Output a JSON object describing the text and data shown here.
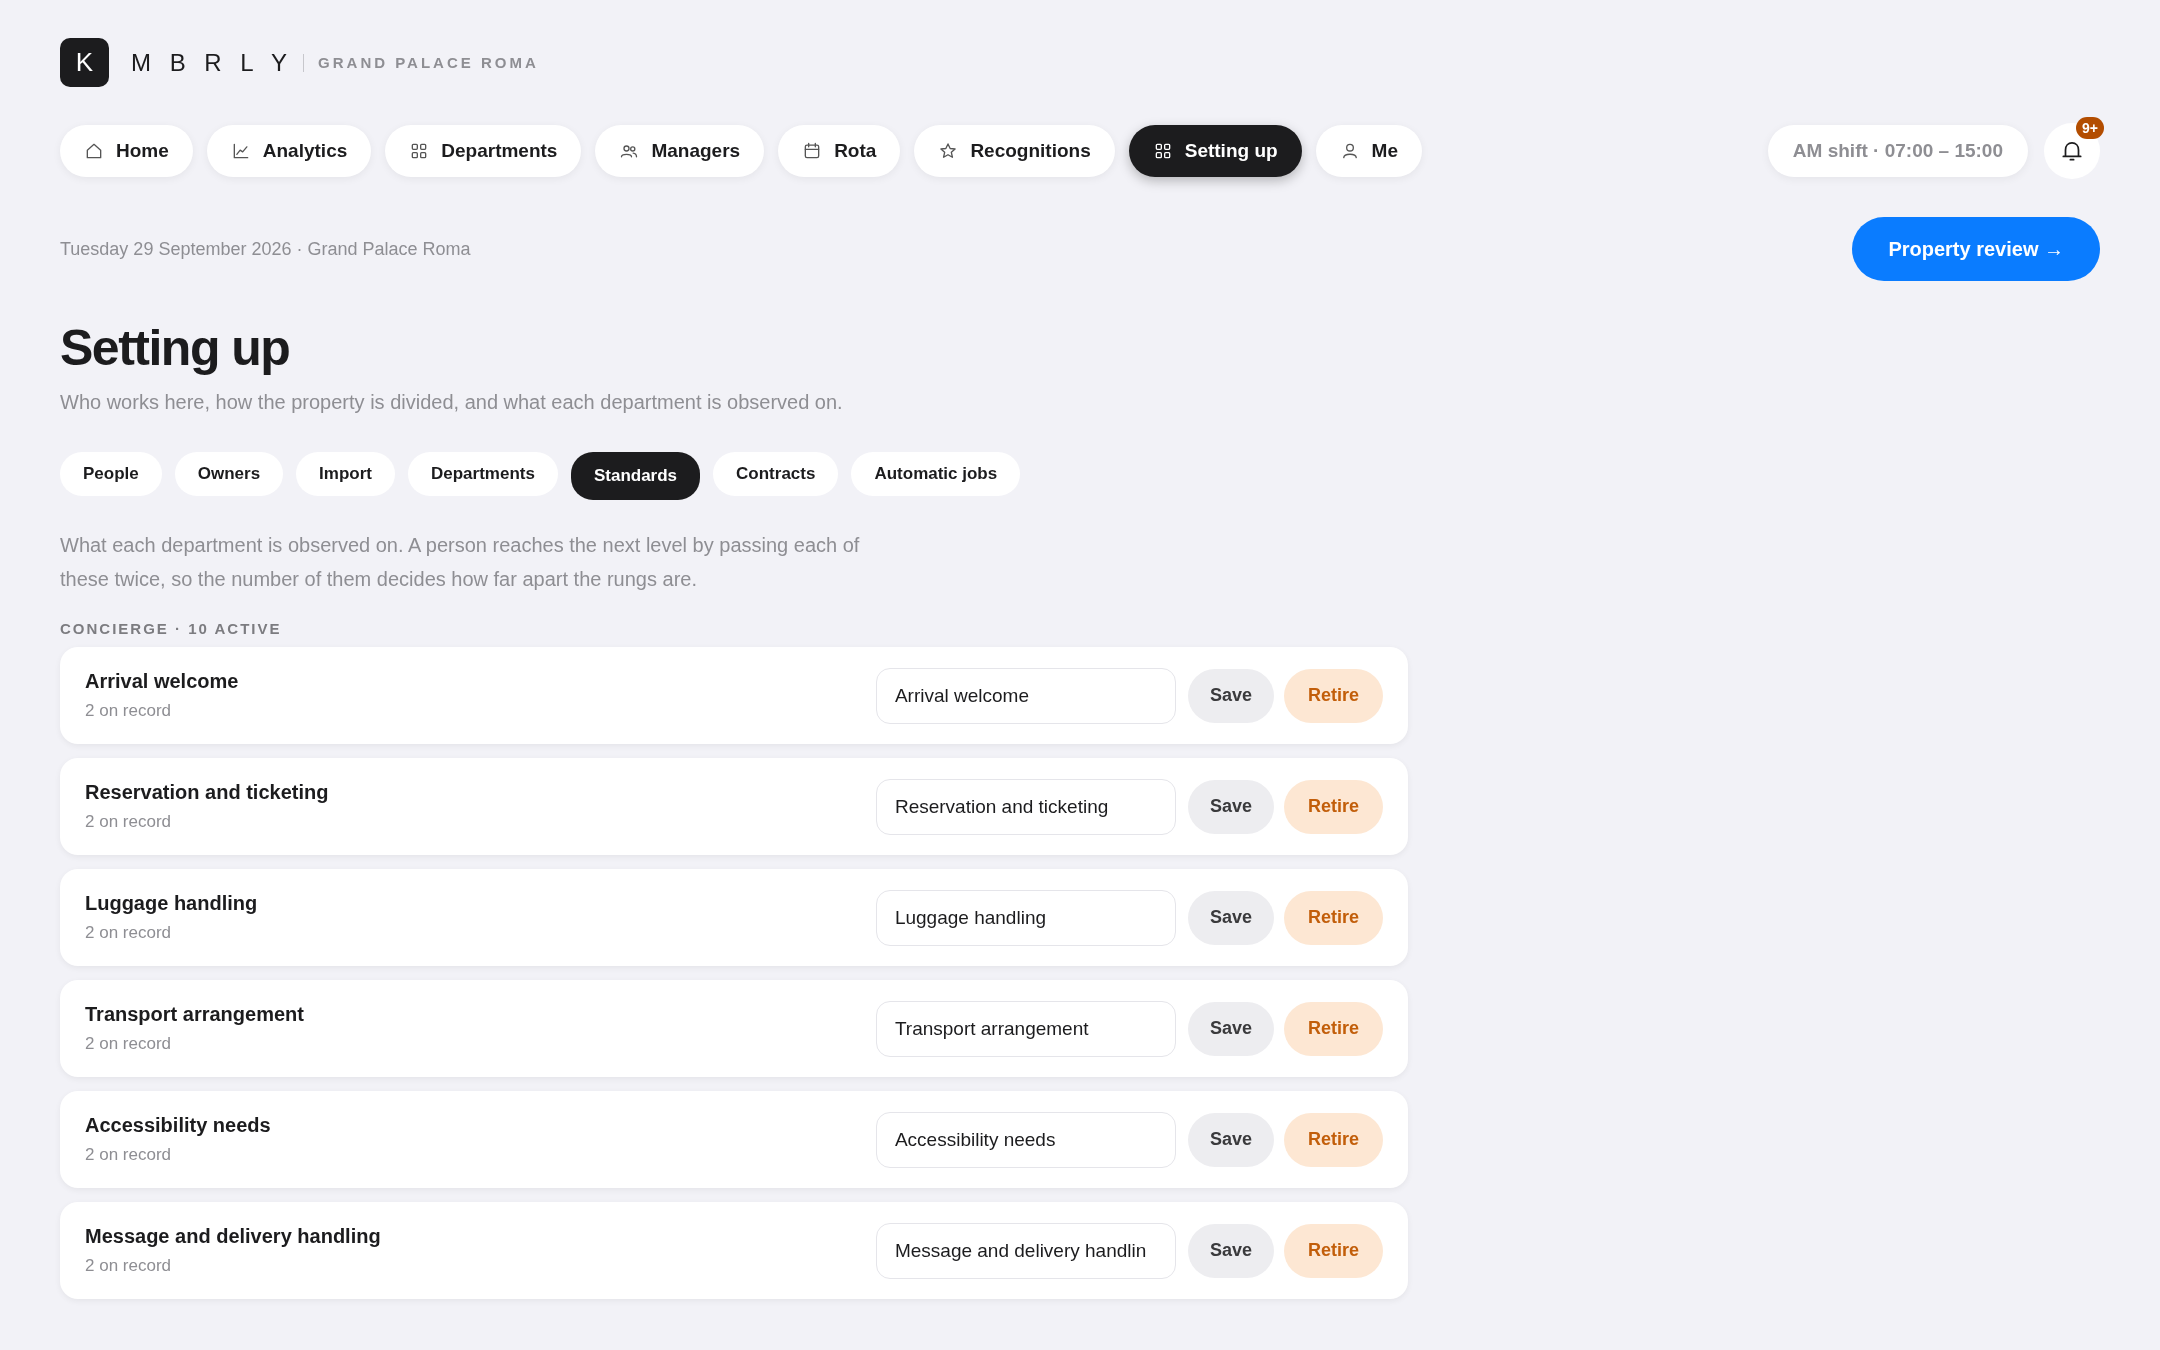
{
  "brand": {
    "logo": "K",
    "name": "M B R L Y",
    "property": "GRAND PALACE ROMA"
  },
  "nav": [
    {
      "label": "Home",
      "selected": false
    },
    {
      "label": "Analytics",
      "selected": false
    },
    {
      "label": "Departments",
      "selected": false
    },
    {
      "label": "Managers",
      "selected": false
    },
    {
      "label": "Rota",
      "selected": false
    },
    {
      "label": "Recognitions",
      "selected": false
    },
    {
      "label": "Setting up",
      "selected": true
    },
    {
      "label": "Me",
      "selected": false
    }
  ],
  "shift": "AM shift · 07:00 – 15:00",
  "notifications": {
    "badge": "9+"
  },
  "date_line": "Tuesday 29 September 2026 · Grand Palace Roma",
  "primary_action": "Property review →",
  "title": "Setting up",
  "subtitle": "Who works here, how the property is divided, and what each department is observed on.",
  "tabs": [
    {
      "label": "People",
      "selected": false
    },
    {
      "label": "Owners",
      "selected": false
    },
    {
      "label": "Import",
      "selected": false
    },
    {
      "label": "Departments",
      "selected": false
    },
    {
      "label": "Standards",
      "selected": true
    },
    {
      "label": "Contracts",
      "selected": false
    },
    {
      "label": "Automatic jobs",
      "selected": false
    }
  ],
  "description": "What each department is observed on. A person reaches the next level by passing each of these twice, so the number of them decides how far apart the rungs are.",
  "section_label": "CONCIERGE · 10 ACTIVE",
  "standards": [
    {
      "name": "Arrival welcome",
      "count": "2 on record",
      "value": "Arrival welcome",
      "save": "Save",
      "retire": "Retire"
    },
    {
      "name": "Reservation and ticketing",
      "count": "2 on record",
      "value": "Reservation and ticketing",
      "save": "Save",
      "retire": "Retire"
    },
    {
      "name": "Luggage handling",
      "count": "2 on record",
      "value": "Luggage handling",
      "save": "Save",
      "retire": "Retire"
    },
    {
      "name": "Transport arrangement",
      "count": "2 on record",
      "value": "Transport arrangement",
      "save": "Save",
      "retire": "Retire"
    },
    {
      "name": "Accessibility needs",
      "count": "2 on record",
      "value": "Accessibility needs",
      "save": "Save",
      "retire": "Retire"
    },
    {
      "name": "Message and delivery handling",
      "count": "2 on record",
      "value": "Message and delivery handlin",
      "save": "Save",
      "retire": "Retire"
    }
  ]
}
